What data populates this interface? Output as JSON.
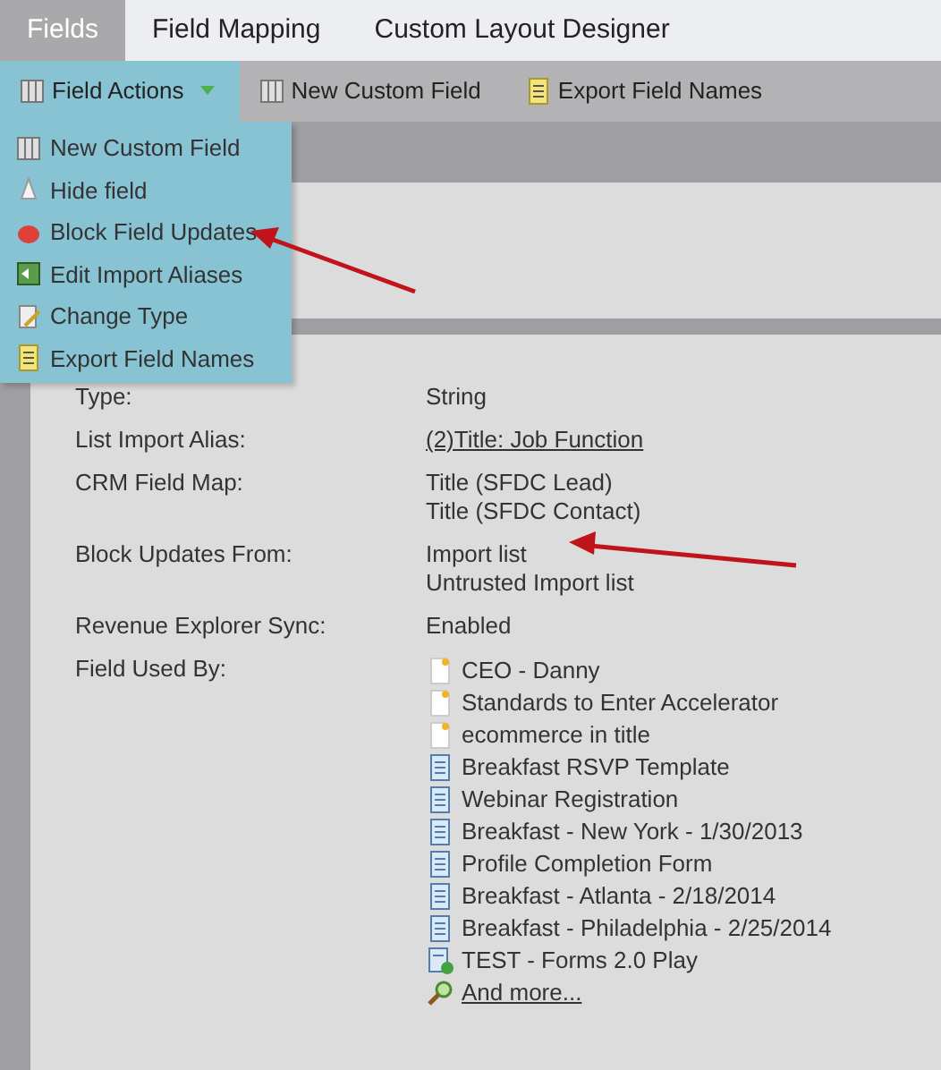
{
  "tabs": [
    {
      "label": "Fields",
      "selected": true
    },
    {
      "label": "Field Mapping",
      "selected": false
    },
    {
      "label": "Custom Layout Designer",
      "selected": false
    }
  ],
  "toolbar": [
    {
      "label": "Field Actions",
      "kind": "menu",
      "selected": true
    },
    {
      "label": "New Custom Field",
      "kind": "database",
      "selected": false
    },
    {
      "label": "Export Field Names",
      "kind": "export",
      "selected": false
    }
  ],
  "menu": [
    {
      "label": "New Custom Field",
      "kind": "database"
    },
    {
      "label": "Hide field",
      "kind": "hide"
    },
    {
      "label": "Block Field Updates",
      "kind": "block"
    },
    {
      "label": "Edit Import Aliases",
      "kind": "alias"
    },
    {
      "label": "Change Type",
      "kind": "type"
    },
    {
      "label": "Export Field Names",
      "kind": "export"
    }
  ],
  "details": [
    {
      "label": "Type:",
      "values": [
        "String"
      ]
    },
    {
      "label": "List Import Alias:",
      "kind": "link",
      "values": [
        "(2)Title: Job Function"
      ]
    },
    {
      "label": "CRM Field Map:",
      "values": [
        "Title (SFDC Lead)",
        "Title (SFDC Contact)"
      ]
    },
    {
      "label": "Block Updates From:",
      "values": [
        "Import list",
        "Untrusted Import list"
      ]
    },
    {
      "label": "Revenue Explorer Sync:",
      "values": [
        "Enabled"
      ]
    },
    {
      "label": "Field Used By:",
      "kind": "usage",
      "items": [
        {
          "label": "CEO - Danny",
          "kind": "note"
        },
        {
          "label": "Standards to Enter Accelerator",
          "kind": "note"
        },
        {
          "label": "ecommerce in title",
          "kind": "note"
        },
        {
          "label": "Breakfast RSVP Template",
          "kind": "form"
        },
        {
          "label": "Webinar Registration",
          "kind": "form"
        },
        {
          "label": "Breakfast - New York - 1/30/2013",
          "kind": "form"
        },
        {
          "label": "Profile Completion Form",
          "kind": "form"
        },
        {
          "label": "Breakfast - Atlanta - 2/18/2014",
          "kind": "form"
        },
        {
          "label": "Breakfast - Philadelphia - 2/25/2014",
          "kind": "form"
        },
        {
          "label": "TEST - Forms 2.0 Play",
          "kind": "approved"
        },
        {
          "label": "And more...",
          "kind": "more"
        }
      ]
    }
  ]
}
